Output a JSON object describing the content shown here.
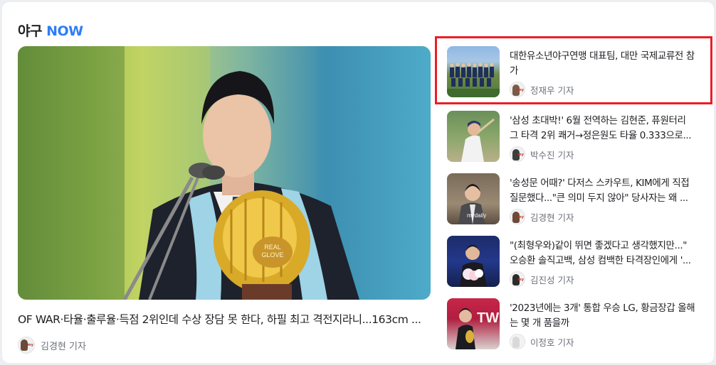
{
  "section": {
    "title_prefix": "야구",
    "title_accent": "NOW"
  },
  "main_article": {
    "title": "OF WAR·타율·출루율·득점 2위인데 수상 장담 못 한다, 하필 최고 격전지라니...163cm ...",
    "reporter": "김경현 기자",
    "image_glove_text": "REAL GLOVE AWARD"
  },
  "side_articles": [
    {
      "title": "대한유소년야구연맹 대표팀, 대만 국제교류전 참가",
      "reporter": "정재우 기자",
      "highlighted": true
    },
    {
      "title": "'삼성 초대박!' 6월 전역하는 김현준, 퓨원터리 그 타격 2위 쾌거→정은원도 타율 0.333으로...",
      "reporter": "박수진 기자",
      "highlighted": false
    },
    {
      "title": "'송성문 어때?' 다저스 스카우트, KIM에게 직접 질문했다...\"큰 의미 두지 않아\" 당사자는 왜 ...",
      "reporter": "김경현 기자",
      "highlighted": false
    },
    {
      "title": "\"(최형우와)같이 뛰면 좋겠다고 생각했지만...\" 오승환 솔직고백, 삼성 컴백한 타격장인에게 '...",
      "reporter": "김진성 기자",
      "highlighted": false
    },
    {
      "title": "'2023년에는 3개' 통합 우승 LG, 황금장갑 올해는 몇 개 품을까",
      "reporter": "이정호 기자",
      "highlighted": false
    }
  ],
  "colors": {
    "accent": "#2f7df6",
    "highlight": "#ee1c25",
    "reporter_text": "#6d7079"
  }
}
